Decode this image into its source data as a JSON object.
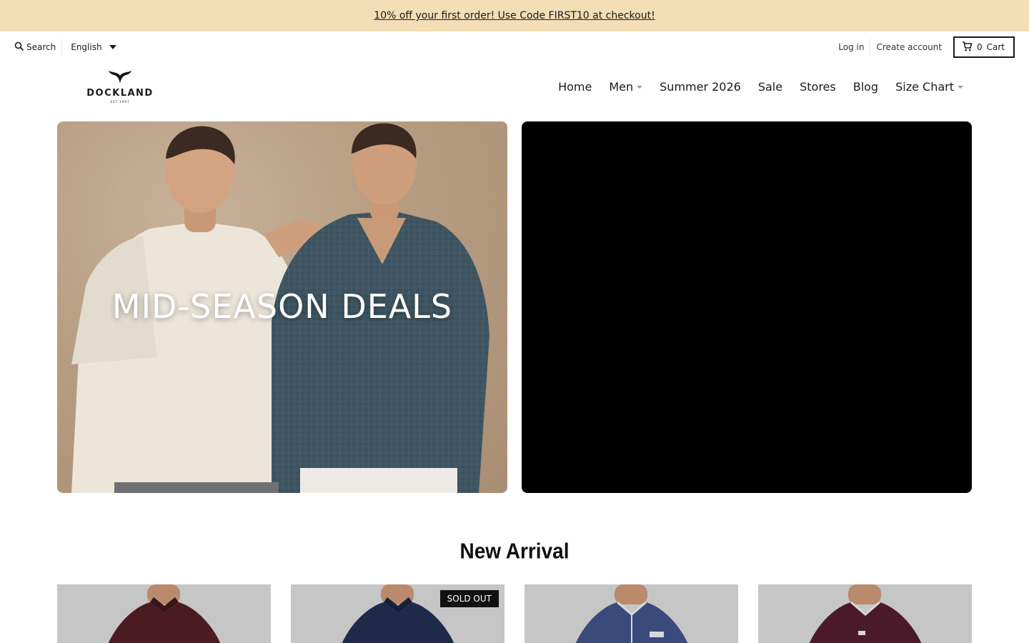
{
  "announcement": {
    "text": "10% off your first order! Use Code FIRST10 at checkout!"
  },
  "utility": {
    "search_label": "Search",
    "language": "English",
    "login": "Log in",
    "create_account": "Create account",
    "cart_count": "0",
    "cart_label": "Cart"
  },
  "header": {
    "logo_text": "DOCKLAND",
    "logo_sub": "EST 1997",
    "nav": [
      {
        "label": "Home"
      },
      {
        "label": "Men"
      },
      {
        "label": "Summer 2026"
      },
      {
        "label": "Sale"
      },
      {
        "label": "Stores"
      },
      {
        "label": "Blog"
      },
      {
        "label": "Size Chart"
      }
    ]
  },
  "hero": {
    "title": "MID-SEASON DEALS"
  },
  "new_arrival": {
    "title": "New Arrival",
    "products": [
      {
        "shirt_color": "#4a1c22"
      },
      {
        "shirt_color": "#1f2a4a",
        "badge": "SOLD OUT"
      },
      {
        "shirt_color": "#3a4a7a"
      },
      {
        "shirt_color": "#4a1a2a"
      }
    ]
  },
  "colors": {
    "announcement_bg": "#f3deb6",
    "hero_right_bg": "#000000",
    "product_bg": "#c6c6c6"
  }
}
